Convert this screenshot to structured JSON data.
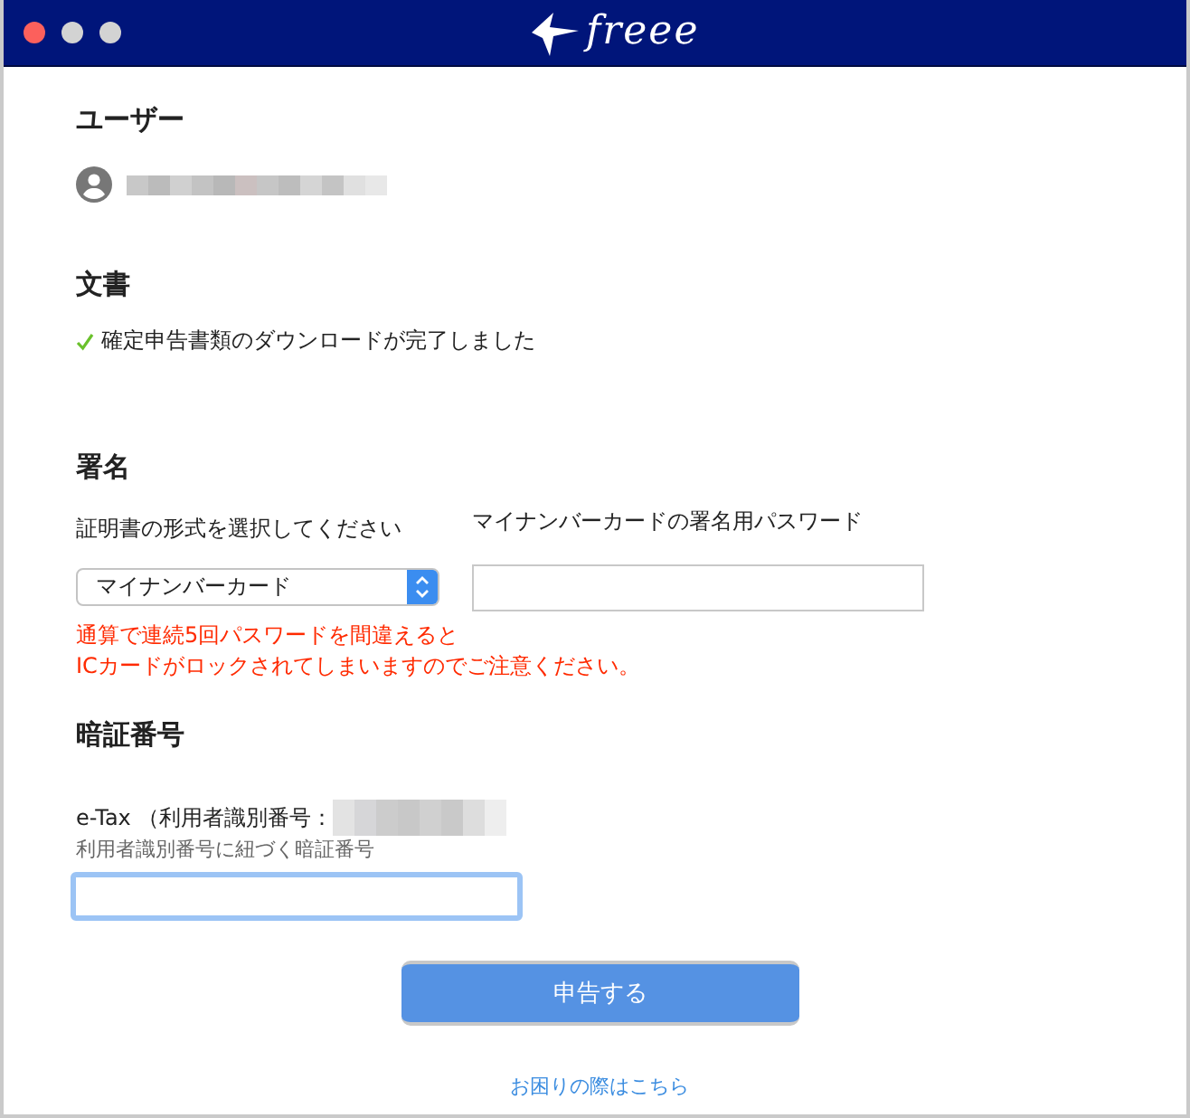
{
  "window": {
    "controls": [
      {
        "color": "#fc605c"
      },
      {
        "color": "#d3d3d3"
      },
      {
        "color": "#d3d3d3"
      }
    ],
    "logo": "freee"
  },
  "user": {
    "heading": "ユーザー"
  },
  "document": {
    "heading": "文書",
    "status": {
      "text": "確定申告書類のダウンロードが完了しました",
      "done": true
    }
  },
  "signature": {
    "heading": "署名",
    "certificate": {
      "label": "証明書の形式を選択してください",
      "value": "マイナンバーカード"
    },
    "password": {
      "label": "マイナンバーカードの署名用パスワード"
    },
    "warning": [
      "通算で連続5回パスワードを間違えると",
      "ICカードがロックされてしまいますのでご注意ください。"
    ]
  },
  "pin": {
    "heading": "暗証番号",
    "label": "e-Tax （利用者識別番号：",
    "hint": "利用者識別番号に紐づく暗証番号",
    "focused": true
  },
  "submit": "申告する",
  "help_link": "お困りの際はこちら"
}
